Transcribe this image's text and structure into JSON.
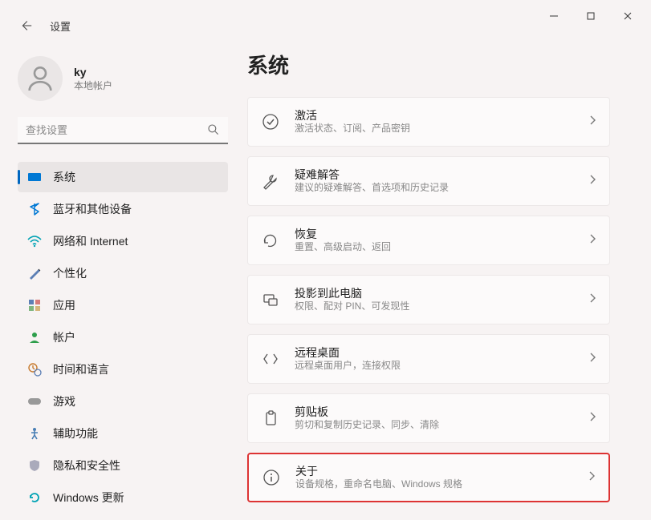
{
  "app_title": "设置",
  "profile": {
    "name": "ky",
    "subtitle": "本地帐户"
  },
  "search": {
    "placeholder": "查找设置"
  },
  "page_title": "系统",
  "sidebar": {
    "items": [
      {
        "label": "系统"
      },
      {
        "label": "蓝牙和其他设备"
      },
      {
        "label": "网络和 Internet"
      },
      {
        "label": "个性化"
      },
      {
        "label": "应用"
      },
      {
        "label": "帐户"
      },
      {
        "label": "时间和语言"
      },
      {
        "label": "游戏"
      },
      {
        "label": "辅助功能"
      },
      {
        "label": "隐私和安全性"
      },
      {
        "label": "Windows 更新"
      }
    ]
  },
  "cards": [
    {
      "title": "激活",
      "sub": "激活状态、订阅、产品密钥"
    },
    {
      "title": "疑难解答",
      "sub": "建议的疑难解答、首选项和历史记录"
    },
    {
      "title": "恢复",
      "sub": "重置、高级启动、返回"
    },
    {
      "title": "投影到此电脑",
      "sub": "权限、配对 PIN、可发现性"
    },
    {
      "title": "远程桌面",
      "sub": "远程桌面用户，连接权限"
    },
    {
      "title": "剪贴板",
      "sub": "剪切和复制历史记录、同步、清除"
    },
    {
      "title": "关于",
      "sub": "设备规格，重命名电脑、Windows 规格"
    }
  ]
}
